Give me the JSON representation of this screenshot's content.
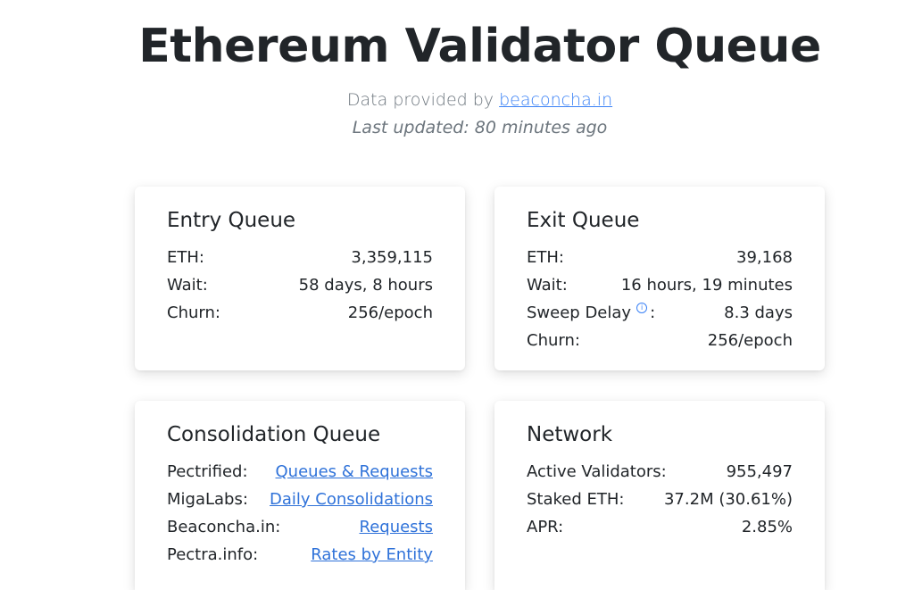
{
  "header": {
    "title": "Ethereum Validator Queue",
    "provided_by_prefix": "Data provided by",
    "provided_by_link": "beaconcha.in",
    "last_updated": "Last updated: 80 minutes ago"
  },
  "entry_queue": {
    "title": "Entry Queue",
    "rows": [
      {
        "label": "ETH:",
        "value": "3,359,115"
      },
      {
        "label": "Wait:",
        "value": "58 days, 8 hours"
      },
      {
        "label": "Churn:",
        "value": "256/epoch"
      }
    ]
  },
  "exit_queue": {
    "title": "Exit Queue",
    "rows": [
      {
        "label": "ETH:",
        "value": "39,168"
      },
      {
        "label": "Wait:",
        "value": "16 hours, 19 minutes"
      },
      {
        "label": "Sweep Delay",
        "suffix": ":",
        "icon": "info-icon",
        "value": "8.3 days"
      },
      {
        "label": "Churn:",
        "value": "256/epoch"
      }
    ]
  },
  "consolidation_queue": {
    "title": "Consolidation Queue",
    "rows": [
      {
        "label": "Pectrified:",
        "link": "Queues & Requests"
      },
      {
        "label": "MigaLabs:",
        "link": "Daily Consolidations"
      },
      {
        "label": "Beaconcha.in:",
        "link": "Requests"
      },
      {
        "label": "Pectra.info:",
        "link": "Rates by Entity"
      }
    ]
  },
  "network": {
    "title": "Network",
    "rows": [
      {
        "label": "Active Validators:",
        "value": "955,497"
      },
      {
        "label": "Staked ETH:",
        "value": "37.2M (30.61%)"
      },
      {
        "label": "APR:",
        "value": "2.85%"
      }
    ]
  },
  "colors": {
    "text": "#212529",
    "muted": "#6c757d",
    "link": "#2f72d9"
  }
}
